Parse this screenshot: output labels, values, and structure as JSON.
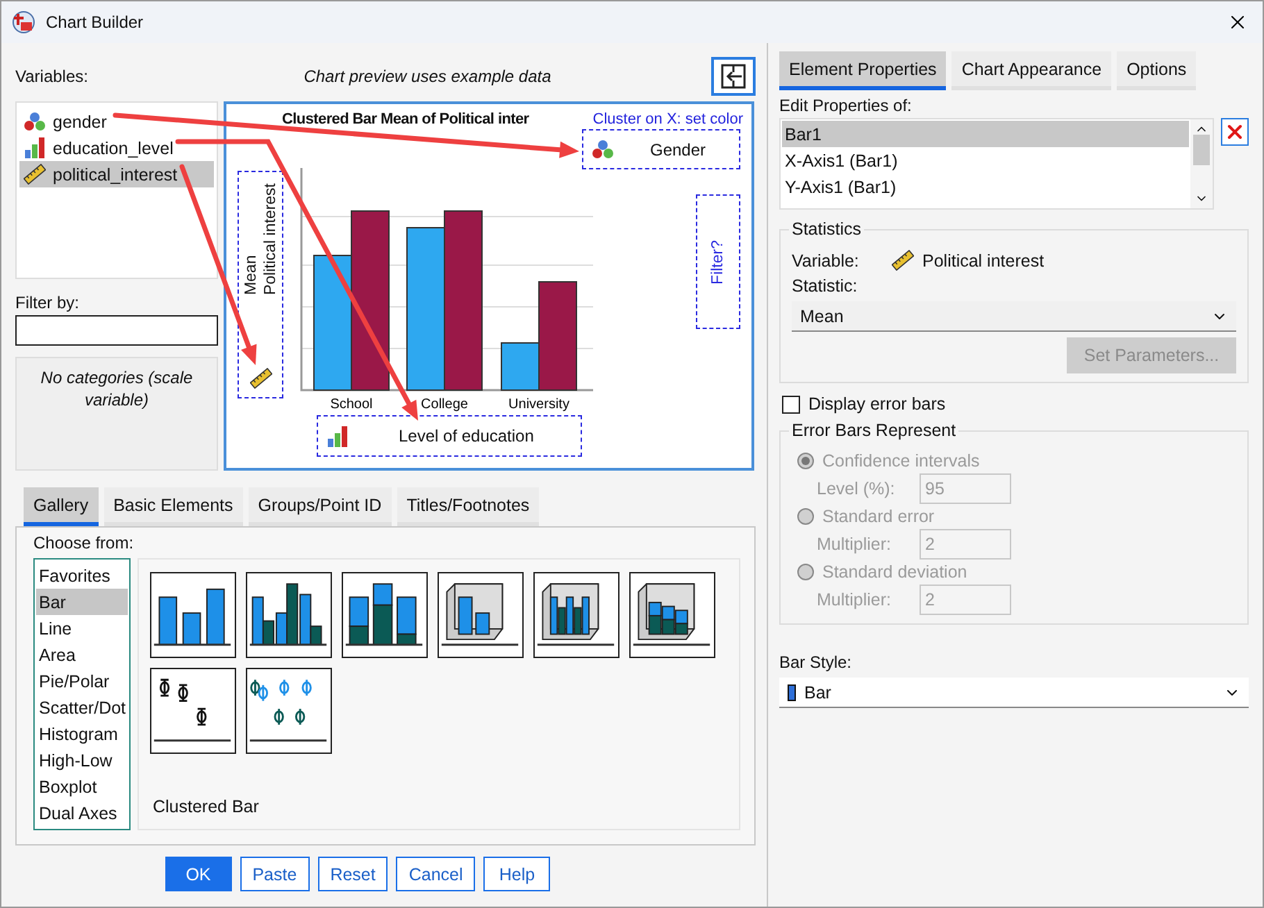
{
  "window": {
    "title": "Chart Builder"
  },
  "variables": {
    "label": "Variables:",
    "items": [
      {
        "name": "gender",
        "kind": "nominal",
        "selected": false
      },
      {
        "name": "education_level",
        "kind": "ordinal",
        "selected": false
      },
      {
        "name": "political_interest",
        "kind": "scale",
        "selected": true
      }
    ]
  },
  "preview_note": "Chart preview uses example data",
  "filter": {
    "label": "Filter by:",
    "note": "No categories (scale variable)"
  },
  "preview": {
    "title": "Clustered Bar Mean of Political inter",
    "cluster_hint": "Cluster on X: set color",
    "cluster_zone": {
      "label": "Gender",
      "kind": "nominal"
    },
    "y_zone": {
      "lines": [
        "Mean",
        "Political interest"
      ],
      "kind": "scale"
    },
    "filter_zone": "Filter?",
    "x_zone": {
      "label": "Level of education",
      "kind": "ordinal"
    },
    "categories": [
      "School",
      "College",
      "University"
    ]
  },
  "gallery": {
    "tabs": [
      {
        "label": "Gallery",
        "selected": true
      },
      {
        "label": "Basic Elements",
        "selected": false
      },
      {
        "label": "Groups/Point ID",
        "selected": false
      },
      {
        "label": "Titles/Footnotes",
        "selected": false
      }
    ],
    "choose_label": "Choose from:",
    "types": [
      {
        "label": "Favorites",
        "selected": false
      },
      {
        "label": "Bar",
        "selected": true
      },
      {
        "label": "Line",
        "selected": false
      },
      {
        "label": "Area",
        "selected": false
      },
      {
        "label": "Pie/Polar",
        "selected": false
      },
      {
        "label": "Scatter/Dot",
        "selected": false
      },
      {
        "label": "Histogram",
        "selected": false
      },
      {
        "label": "High-Low",
        "selected": false
      },
      {
        "label": "Boxplot",
        "selected": false
      },
      {
        "label": "Dual Axes",
        "selected": false
      }
    ],
    "thumbnails": [
      {
        "kind": "simple"
      },
      {
        "kind": "clustered"
      },
      {
        "kind": "stacked"
      },
      {
        "kind": "simple3d"
      },
      {
        "kind": "clustered3d"
      },
      {
        "kind": "stacked3d"
      },
      {
        "kind": "error"
      },
      {
        "kind": "error_clustered"
      }
    ],
    "caption": "Clustered Bar"
  },
  "buttons": [
    {
      "label": "OK",
      "kind": "primary"
    },
    {
      "label": "Paste",
      "kind": "normal"
    },
    {
      "label": "Reset",
      "kind": "normal"
    },
    {
      "label": "Cancel",
      "kind": "normal"
    },
    {
      "label": "Help",
      "kind": "normal"
    }
  ],
  "properties": {
    "tabs": [
      {
        "label": "Element Properties",
        "selected": true
      },
      {
        "label": "Chart Appearance",
        "selected": false
      },
      {
        "label": "Options",
        "selected": false
      }
    ],
    "edit_label": "Edit Properties of:",
    "elements": [
      {
        "label": "Bar1",
        "selected": true
      },
      {
        "label": "X-Axis1 (Bar1)",
        "selected": false
      },
      {
        "label": "Y-Axis1 (Bar1)",
        "selected": false
      }
    ],
    "statistics": {
      "title": "Statistics",
      "variable_label": "Variable:",
      "variable_value": "Political interest",
      "statistic_label": "Statistic:",
      "statistic_value": "Mean",
      "set_parameters": {
        "label": "Set Parameters...",
        "disabled": true
      }
    },
    "error_bars_checkbox": {
      "label": "Display error bars",
      "checked": false
    },
    "error_bars": {
      "title": "Error Bars Represent",
      "disabled": true,
      "options": [
        {
          "label": "Confidence intervals",
          "selected": true,
          "field_label": "Level (%):",
          "field_value": "95"
        },
        {
          "label": "Standard error",
          "selected": false,
          "field_label": "Multiplier:",
          "field_value": "2"
        },
        {
          "label": "Standard deviation",
          "selected": false,
          "field_label": "Multiplier:",
          "field_value": "2"
        }
      ]
    },
    "bar_style": {
      "label": "Bar Style:",
      "value": "Bar"
    }
  }
}
